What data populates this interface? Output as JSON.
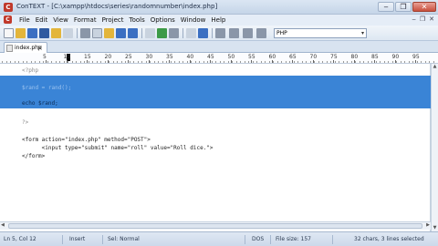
{
  "window": {
    "title": "ConTEXT - [C:\\xampp\\htdocs\\series\\randomnumber\\index.php]",
    "app_icon": "C",
    "min": "‒",
    "restore": "❐",
    "close": "✕"
  },
  "menu": {
    "items": [
      "File",
      "Edit",
      "View",
      "Format",
      "Project",
      "Tools",
      "Options",
      "Window",
      "Help"
    ],
    "mdi_controls": [
      "‒",
      "❐",
      "✕"
    ]
  },
  "toolbar": {
    "language": "PHP",
    "language_chevron": "▾",
    "icons": [
      "new-file-icon",
      "open-folder-icon",
      "save-icon",
      "save-all-icon",
      "close-file-icon",
      "print-icon",
      "cut-icon",
      "copy-icon",
      "paste-icon",
      "undo-icon",
      "redo-icon",
      "find-icon",
      "find-replace-icon",
      "find-next-icon",
      "record-macro-icon",
      "play-macro-icon",
      "run-f9-icon",
      "run-f10-icon",
      "run-f11-icon",
      "run-f12-icon"
    ],
    "colors": {
      "blue": "#3b6fc2",
      "yellow": "#e3b53a",
      "red": "#c0392b",
      "gray": "#8a96a8",
      "green": "#3c9a47"
    }
  },
  "tab": {
    "label": "index.php",
    "close": "×"
  },
  "ruler": {
    "labels": [
      "5",
      "10",
      "15",
      "20",
      "25",
      "30",
      "35",
      "40",
      "45",
      "50",
      "55",
      "60",
      "65",
      "70",
      "75",
      "80",
      "85",
      "90",
      "95"
    ]
  },
  "editor": {
    "lines": [
      "<?php",
      "",
      "$rand = rand();",
      "",
      "echo $rand;",
      "",
      "?>",
      "",
      "<form action=\"index.php\" method=\"POST\">",
      "      <input type=\"submit\" name=\"roll\" value=\"Roll dice.\">",
      "</form>"
    ],
    "selection_color": "#3a84d6"
  },
  "status": {
    "position": "Ln 5, Col 12",
    "mode": "Insert",
    "sel_mode": "Sel: Normal",
    "eol": "DOS",
    "file_size": "File size: 157",
    "selection_info": "32 chars, 3 lines selected"
  }
}
